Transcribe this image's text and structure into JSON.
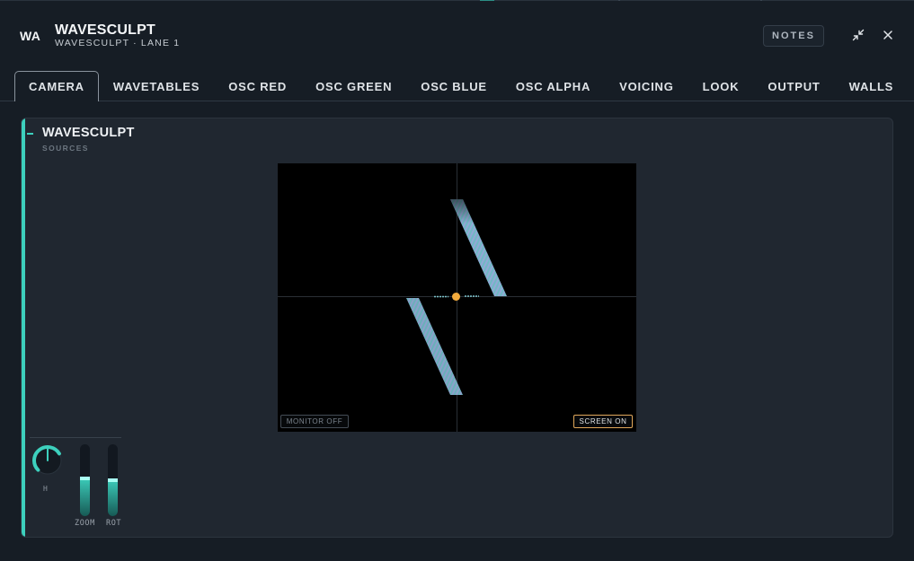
{
  "header": {
    "badge": "WA",
    "title": "WAVESCULPT",
    "subtitle": "WAVESCULPT · LANE 1",
    "notes_label": "NOTES",
    "minimize_icon": "minimize-arrows-icon",
    "close_icon": "close-icon"
  },
  "tabs": [
    {
      "label": "CAMERA",
      "active": true
    },
    {
      "label": "WAVETABLES",
      "active": false
    },
    {
      "label": "OSC RED",
      "active": false
    },
    {
      "label": "OSC GREEN",
      "active": false
    },
    {
      "label": "OSC BLUE",
      "active": false
    },
    {
      "label": "OSC ALPHA",
      "active": false
    },
    {
      "label": "VOICING",
      "active": false
    },
    {
      "label": "LOOK",
      "active": false
    },
    {
      "label": "OUTPUT",
      "active": false
    },
    {
      "label": "WALLS",
      "active": false
    }
  ],
  "panel": {
    "title": "WAVESCULPT",
    "subtitle": "SOURCES",
    "accent_color": "#3dd0bd"
  },
  "viewport": {
    "monitor_label": "MONITOR OFF",
    "screen_label": "SCREEN ON",
    "screen_on_border": "#e0a75a",
    "center_dot_color": "#f2aa3c"
  },
  "controls": {
    "knob": {
      "label": "H",
      "value_fraction": 0.72
    },
    "zoom": {
      "label": "ZOOM",
      "value_fraction": 0.55
    },
    "rot": {
      "label": "ROT",
      "value_fraction": 0.52
    }
  }
}
